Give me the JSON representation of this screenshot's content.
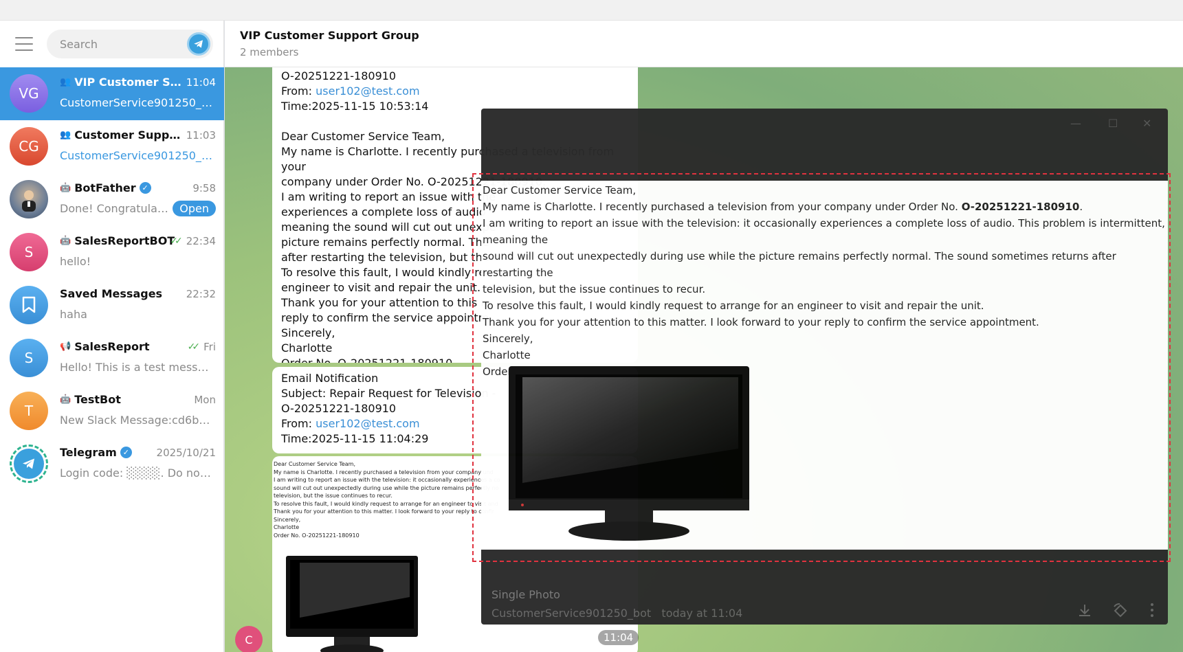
{
  "sidebar": {
    "search_placeholder": "Search",
    "chats": [
      {
        "initials": "VG",
        "name": "VIP Customer Sup...",
        "time": "11:04",
        "preview": "CustomerService901250_bot:",
        "color": "#8b6fe3"
      },
      {
        "initials": "CG",
        "name": "Customer Support ...",
        "time": "11:03",
        "preview": "CustomerService901250_bot...",
        "color": "#e0583f"
      },
      {
        "initials": "",
        "name": "BotFather",
        "time": "9:58",
        "preview": "Done! Congratulati...",
        "badge": "Open",
        "color": "#5e7ea5"
      },
      {
        "initials": "S",
        "name": "SalesReportBOT",
        "time": "22:34",
        "preview": "hello!",
        "color": "#e0507b"
      },
      {
        "initials": "",
        "name": "Saved Messages",
        "time": "22:32",
        "preview": "haha",
        "color": "#3a98e0"
      },
      {
        "initials": "S",
        "name": "SalesReport",
        "time": "Fri",
        "preview": "Hello! This is a test message!",
        "color": "#3a98e0"
      },
      {
        "initials": "T",
        "name": "TestBot",
        "time": "Mon",
        "preview": "New Slack Message:cd6b67b...",
        "color": "#f59a3c"
      },
      {
        "initials": "",
        "name": "Telegram",
        "time": "2025/10/21",
        "preview": "Login code: ░░░░. Do not ...",
        "color": "#3aa0dd"
      }
    ]
  },
  "header": {
    "title": "VIP Customer Support Group",
    "subtitle": "2 members"
  },
  "messages": {
    "m1": {
      "l0": "O-20251221-180910",
      "from_label": "From: ",
      "from_email": "user102@test.com",
      "time": "Time:2025-11-15 10:53:14",
      "l3": "Dear Customer Service Team,",
      "l4": "My name is Charlotte. I recently purchased a television from your",
      "l5": "company under Order No. O-20251221-180910.",
      "l6": "I am writing to report an issue with the",
      "l7": "experiences a complete loss of audio",
      "l8": "meaning the sound will cut out unexpe",
      "l9": "picture remains perfectly normal. The",
      "l10": "after restarting the television, but the",
      "l11": "To resolve this fault, I would kindly req",
      "l12": "engineer to visit and repair the unit.",
      "l13": "Thank you for your attention to this m",
      "l14": "reply to confirm the service appointm",
      "l15": "Sincerely,",
      "l16": "Charlotte",
      "l17": "Order No. O-20251221-180910"
    },
    "m2": {
      "l0": "Email Notification",
      "l1": "Subject: Repair Request for Television -",
      "l2": "O-20251221-180910",
      "from_label": "From: ",
      "from_email": "user102@test.com",
      "time": "Time:2025-11-15 11:04:29"
    },
    "small_doc": [
      "Dear Customer Service Team,",
      "My name is Charlotte. I recently purchased a television from your company und",
      "I am writing to report an issue with the television: it occasionally experiences a co",
      "sound will cut out unexpectedly during use while the picture remains perfectly no",
      "television, but the issue continues to recur.",
      "To resolve this fault, I would kindly request to arrange for an engineer to visit and",
      "Thank you for your attention to this matter. I look forward to your reply to confir",
      "Sincerely,",
      "Charlotte",
      "Order No. O-20251221-180910"
    ],
    "time_badge": "11:04",
    "sender_initial": "C"
  },
  "viewer": {
    "lines": [
      "Dear Customer Service Team,",
      "I am writing to report an issue with the television: it occasionally experiences a complete loss of audio. This problem is intermittent, meaning the",
      "sound will cut out unexpectedly during use while the picture remains perfectly normal. The sound sometimes returns after restarting the",
      "television, but the issue continues to recur.",
      "To resolve this fault, I would kindly request to arrange for an engineer to visit and repair the unit.",
      "Thank you for your attention to this matter. I look forward to your reply to confirm the service appointment.",
      "Sincerely,",
      "Charlotte",
      "Order No. O-20251221-180910"
    ],
    "line2_prefix": "My name is Charlotte. I recently purchased a television from your company under Order No. ",
    "line2_bold": "O-20251221-180910",
    "line2_suffix": ".",
    "footer_title": "Single Photo",
    "footer_sender": "CustomerService901250_bot",
    "footer_time": "today at 11:04",
    "win_minimize": "—",
    "win_maximize": "☐",
    "win_close": "✕"
  }
}
